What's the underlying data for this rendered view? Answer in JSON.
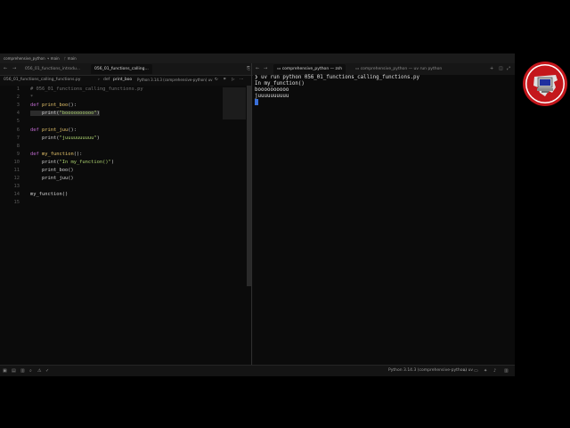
{
  "titlebar": {
    "project": "comprehensive_python",
    "branch": "main",
    "worktree": "main"
  },
  "editor_tabs": [
    {
      "label": "056_01_functions_introdu..."
    },
    {
      "label": "056_01_functions_calling..."
    }
  ],
  "terminal_tabs": [
    {
      "label": "comprehensive_python — zsh"
    },
    {
      "label": "comprehensive_python — uv run python"
    }
  ],
  "breadcrumb": {
    "file": "056_01_functions_calling_functions.py",
    "separator": "›",
    "def_keyword": "def",
    "symbol": "print_boo",
    "interpreter": "Python 3.14.3 (comprehensive-python) uv"
  },
  "code_lines": [
    {
      "num": "1",
      "tokens": [
        {
          "t": "# 056_01_functions_calling_functions.py",
          "c": "cm"
        }
      ]
    },
    {
      "num": "2",
      "tokens": [
        {
          "t": "*",
          "c": "cm"
        }
      ]
    },
    {
      "num": "3",
      "tokens": [
        {
          "t": "def ",
          "c": "kw"
        },
        {
          "t": "print_boo",
          "c": "fn"
        },
        {
          "t": "():",
          "c": ""
        }
      ]
    },
    {
      "num": "4",
      "tokens": [
        {
          "t": "    print(",
          "c": ""
        },
        {
          "t": "\"boooooooooo\"",
          "c": "str"
        },
        {
          "t": ")",
          "c": ""
        }
      ]
    },
    {
      "num": "5",
      "tokens": []
    },
    {
      "num": "6",
      "tokens": [
        {
          "t": "def ",
          "c": "kw"
        },
        {
          "t": "print_juu",
          "c": "fn"
        },
        {
          "t": "():",
          "c": ""
        }
      ]
    },
    {
      "num": "7",
      "tokens": [
        {
          "t": "    print(",
          "c": ""
        },
        {
          "t": "\"juuuuuuuuuu\"",
          "c": "str"
        },
        {
          "t": ")",
          "c": ""
        }
      ]
    },
    {
      "num": "8",
      "tokens": []
    },
    {
      "num": "9",
      "tokens": [
        {
          "t": "def ",
          "c": "kw"
        },
        {
          "t": "my_function",
          "c": "fn"
        },
        {
          "t": "():",
          "c": ""
        }
      ]
    },
    {
      "num": "10",
      "tokens": [
        {
          "t": "    print(",
          "c": ""
        },
        {
          "t": "\"In my_function()\"",
          "c": "str"
        },
        {
          "t": ")",
          "c": ""
        }
      ]
    },
    {
      "num": "11",
      "tokens": [
        {
          "t": "    print_boo()",
          "c": ""
        }
      ]
    },
    {
      "num": "12",
      "tokens": [
        {
          "t": "    print_juu()",
          "c": ""
        }
      ]
    },
    {
      "num": "13",
      "tokens": []
    },
    {
      "num": "14",
      "tokens": [
        {
          "t": "my_function()",
          "c": ""
        }
      ]
    },
    {
      "num": "15",
      "tokens": []
    }
  ],
  "terminal_lines": [
    "❯ uv run python 056_01_functions_calling_functions.py",
    "In my_function()",
    "boooooooooo",
    "juuuuuuuuuu"
  ],
  "statusbar": {
    "interpreter": "Python 3.14.3 (comprehensive-python) uv"
  },
  "colors": {
    "keyword": "#c06bd0",
    "function": "#e6c46b",
    "string": "#a9cf6e",
    "comment": "#6f6f6f",
    "cursor": "#3a6fd8",
    "logo_red": "#c4171c"
  },
  "icons": [
    "chevron-left-icon",
    "chevron-right-icon",
    "plus-icon",
    "split-icon",
    "maximize-icon",
    "refresh-icon",
    "bell-icon",
    "panel-icon",
    "logo-icon"
  ]
}
